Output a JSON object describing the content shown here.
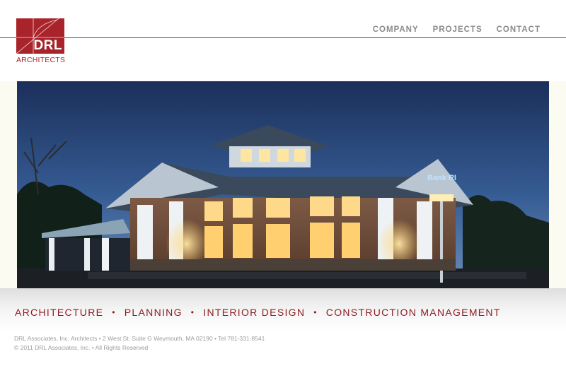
{
  "brand": {
    "logo_mark": "DRL",
    "logo_subtitle": "ARCHITECTS",
    "color": "#a8232a"
  },
  "nav": {
    "items": [
      {
        "label": "COMPANY"
      },
      {
        "label": "PROJECTS"
      },
      {
        "label": "CONTACT"
      }
    ]
  },
  "hero": {
    "building_sign": "Bank RI",
    "icon": "hero-photo-building-dusk"
  },
  "services": {
    "items": [
      {
        "label": "ARCHITECTURE"
      },
      {
        "label": "PLANNING"
      },
      {
        "label": "INTERIOR DESIGN"
      },
      {
        "label": "CONSTRUCTION MANAGEMENT"
      }
    ],
    "separator": "•",
    "color": "#8f1d22"
  },
  "footer": {
    "address": "DRL Associates, Inc. Architects • 2 West St. Suite G Weymouth, MA 02190 • Tel 781-331-8541",
    "copyright": "© 2011 DRL Associates, Inc. • All Rights Reserved"
  }
}
